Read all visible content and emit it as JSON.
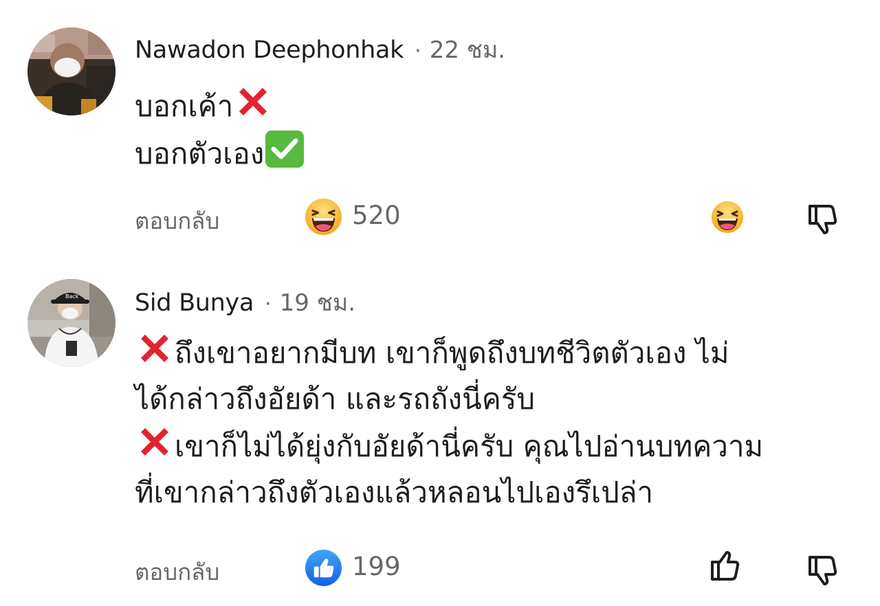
{
  "comments": [
    {
      "author": "Nawadon Deephonhak",
      "separator": "·",
      "time": "22 ชม.",
      "lines": [
        {
          "text": "บอกเค้า",
          "emoji": "cross-mark"
        },
        {
          "text": "บอกตัวเอง",
          "emoji": "check-mark-button"
        }
      ],
      "reply_label": "ตอบกลับ",
      "reaction": "haha",
      "reaction_count": "520"
    },
    {
      "author": "Sid Bunya",
      "separator": "·",
      "time": "19 ชม.",
      "lines": [
        "ถึงเขาอยากมีบท เขาก็พูดถึงบทชีวิตตัวเอง ไม่",
        "ได้กล่าวถึงอัยด้า และรถถังนี่ครับ",
        "เขาก็ไม่ได้ยุ่งกับอัยด้านี่ครับ คุณไปอ่านบทความ",
        "ที่เขากล่าวถึงตัวเองแล้วหลอนไปเองรึเปล่า"
      ],
      "reply_label": "ตอบกลับ",
      "reaction": "like",
      "reaction_count": "199"
    }
  ],
  "colors": {
    "text": "#1c1e21",
    "secondary": "#65676b",
    "like_blue": "#1877f2",
    "haha_yellow": "#f7b125",
    "cross_red": "#e0242f",
    "check_green": "#57b93e"
  }
}
